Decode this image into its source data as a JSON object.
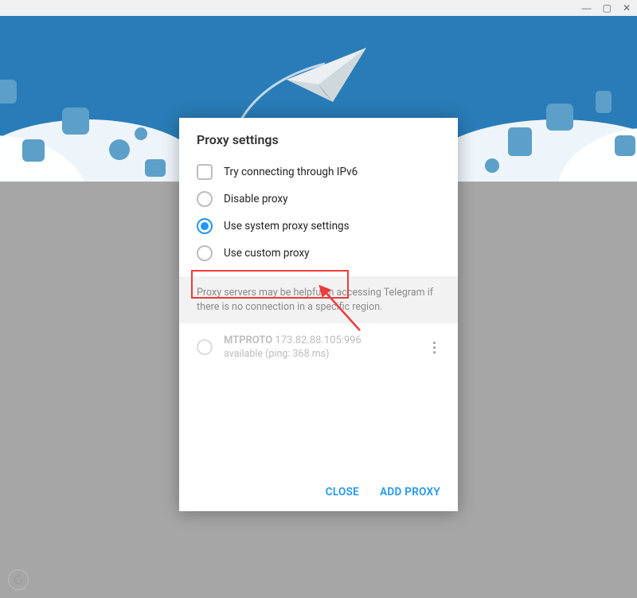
{
  "titlebar": {
    "min": "—",
    "max": "▢",
    "close": "✕"
  },
  "dialog": {
    "title": "Proxy settings",
    "options": {
      "ipv6": "Try connecting through IPv6",
      "disable": "Disable proxy",
      "system": "Use system proxy settings",
      "custom": "Use custom proxy"
    },
    "info": "Proxy servers may be helpful in accessing Telegram if there is no connection in a specific region.",
    "proxy": {
      "protocol": "MTPROTO",
      "address": "173.82.88.105:996",
      "status": "available (ping: 368 ms)"
    },
    "buttons": {
      "close": "CLOSE",
      "add": "ADD PROXY"
    }
  }
}
